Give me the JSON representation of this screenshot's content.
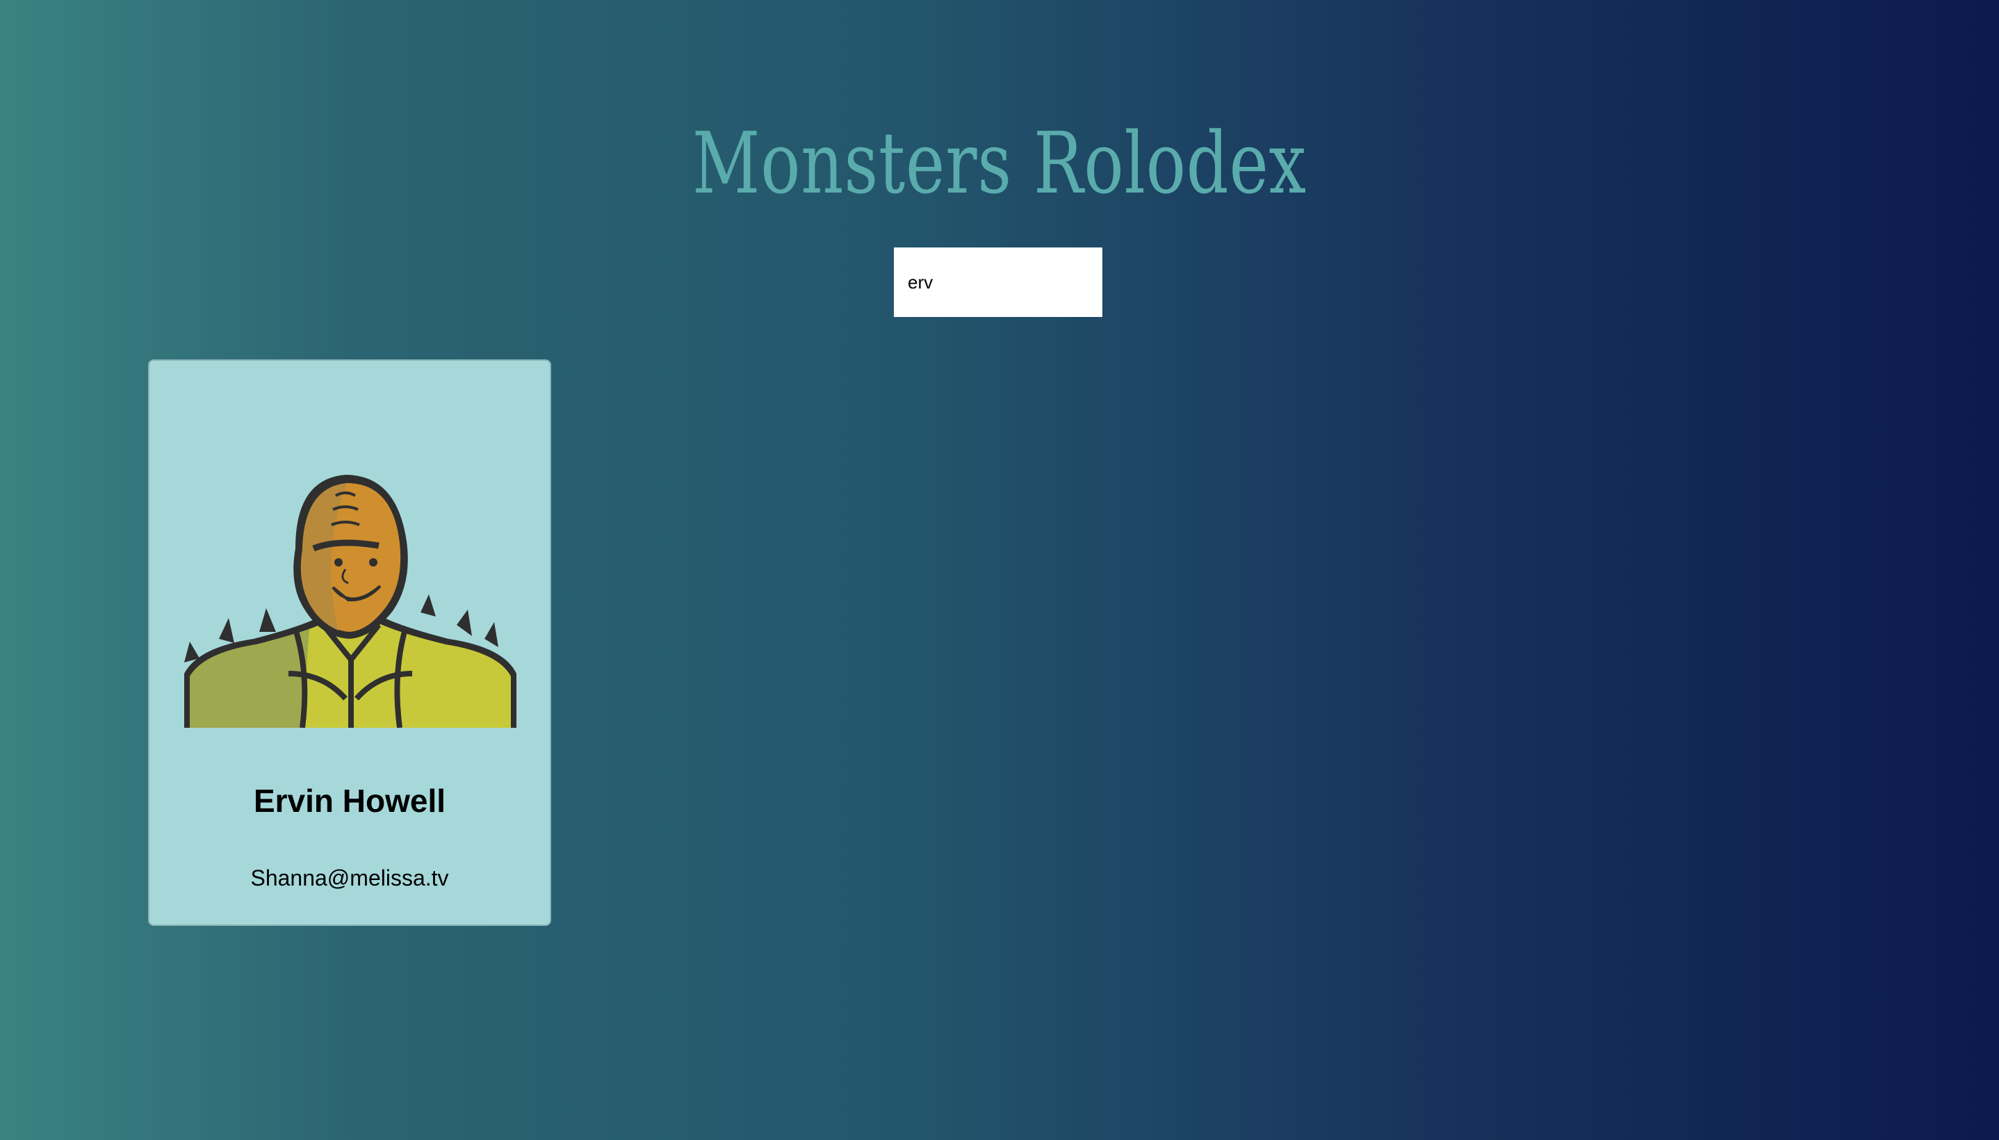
{
  "app": {
    "title": "Monsters Rolodex"
  },
  "search": {
    "value": "erv"
  },
  "monsters": [
    {
      "name": "Ervin Howell",
      "email": "Shanna@melissa.tv",
      "avatar_icon": "monster-avatar-icon"
    }
  ]
}
